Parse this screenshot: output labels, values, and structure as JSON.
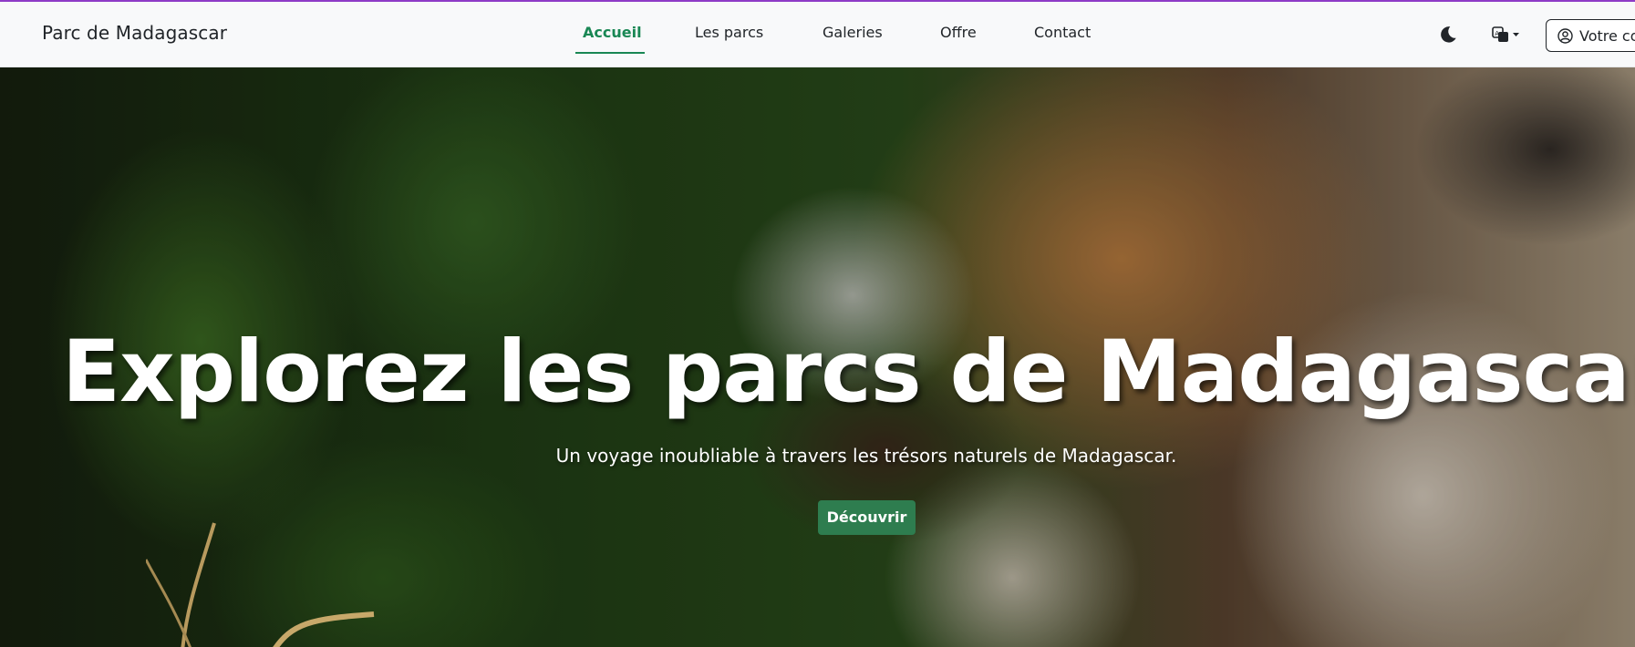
{
  "brand": "Parc de Madagascar",
  "nav": {
    "items": [
      {
        "label": "Accueil"
      },
      {
        "label": "Les parcs"
      },
      {
        "label": "Galeries"
      },
      {
        "label": "Offre"
      },
      {
        "label": "Contact"
      }
    ],
    "active_color": "#198754"
  },
  "toolbar": {
    "theme_icon": "moon-icon",
    "language_icon": "translate-icon",
    "account_label": "Votre co"
  },
  "hero": {
    "title": "Explorez les parcs de Madagascar",
    "subtitle": "Un voyage inoubliable à travers les trésors naturels de Madagascar.",
    "cta_label": "Découvrir",
    "cta_color": "#2e7d4f"
  }
}
